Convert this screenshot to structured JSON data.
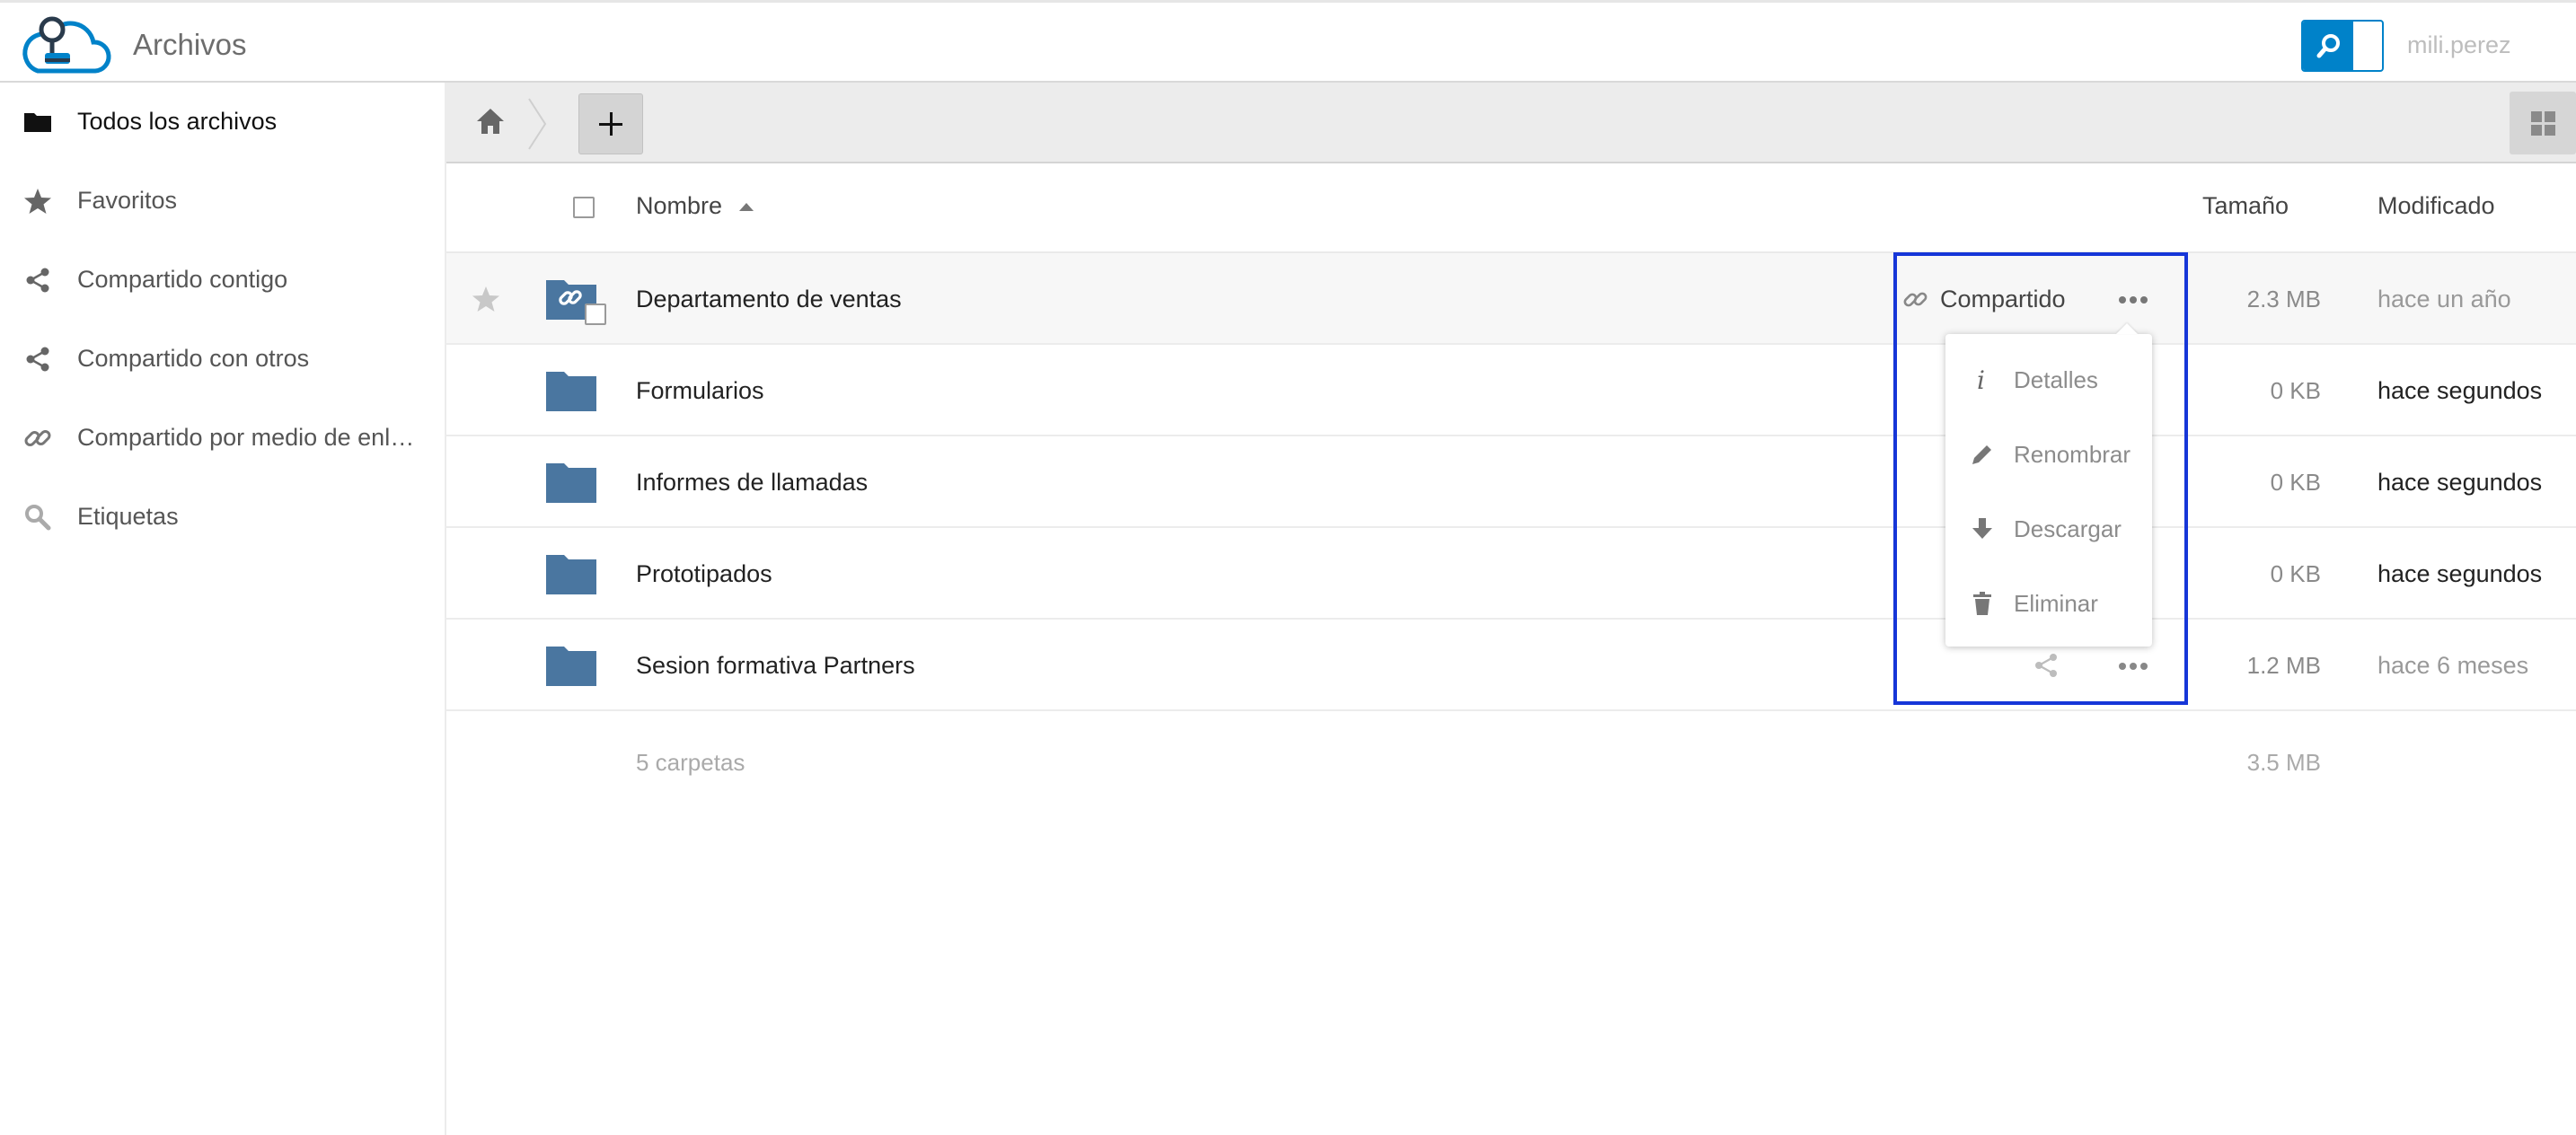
{
  "header": {
    "app_title": "Archivos",
    "username": "mili.perez",
    "logo_icon": "cloud-logo-icon",
    "search_icon": "search-icon"
  },
  "colors": {
    "accent": "#0082c9",
    "folder": "#4a76a0",
    "highlight": "#1636d8"
  },
  "sidebar": {
    "items": [
      {
        "label": "Todos los archivos",
        "icon": "folder-icon",
        "active": true
      },
      {
        "label": "Favoritos",
        "icon": "star-icon"
      },
      {
        "label": "Compartido contigo",
        "icon": "share-icon"
      },
      {
        "label": "Compartido con otros",
        "icon": "share-icon"
      },
      {
        "label": "Compartido por medio de enlac...",
        "icon": "link-icon"
      },
      {
        "label": "Etiquetas",
        "icon": "tag-search-icon"
      }
    ]
  },
  "toolbar": {
    "home_icon": "home-icon",
    "new_icon": "plus-icon",
    "view_icon": "grid-view-icon"
  },
  "list": {
    "columns": {
      "name": "Nombre",
      "size": "Tamaño",
      "modified": "Modificado"
    },
    "rows": [
      {
        "name": "Departamento de ventas",
        "size": "2.3 MB",
        "modified": "hace un año",
        "shared_label": "Compartido"
      },
      {
        "name": "Formularios",
        "size": "0 KB",
        "modified": "hace segundos"
      },
      {
        "name": "Informes de llamadas",
        "size": "0 KB",
        "modified": "hace segundos"
      },
      {
        "name": "Prototipados",
        "size": "0 KB",
        "modified": "hace segundos"
      },
      {
        "name": "Sesion formativa Partners",
        "size": "1.2 MB",
        "modified": "hace 6 meses"
      }
    ],
    "summary": {
      "count": "5 carpetas",
      "total": "3.5 MB"
    }
  },
  "menu": {
    "items": [
      {
        "label": "Detalles",
        "icon": "info-icon"
      },
      {
        "label": "Renombrar",
        "icon": "pencil-icon"
      },
      {
        "label": "Descargar",
        "icon": "download-icon"
      },
      {
        "label": "Eliminar",
        "icon": "trash-icon"
      }
    ]
  }
}
